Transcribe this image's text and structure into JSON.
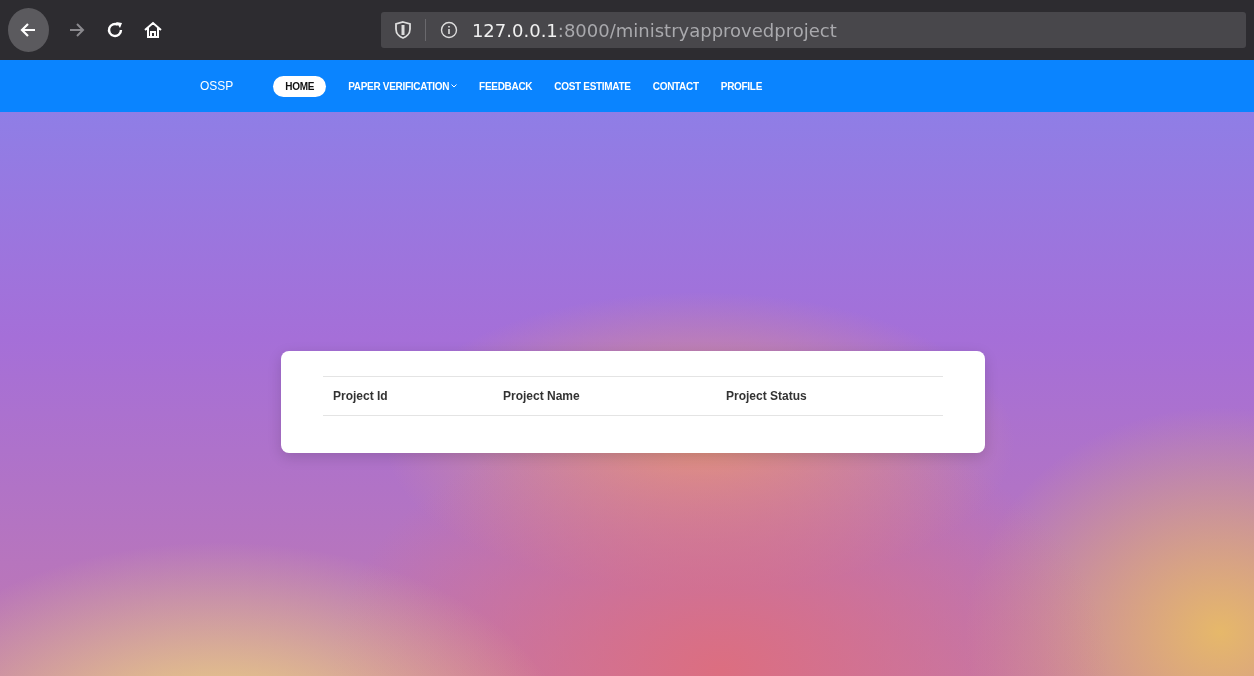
{
  "browser": {
    "url_host": "127.0.0.1",
    "url_path": ":8000/ministryapprovedproject"
  },
  "navbar": {
    "brand": "OSSP",
    "items": [
      {
        "label": "HOME",
        "selected": true,
        "dropdown": false
      },
      {
        "label": "PAPER VERIFICATION",
        "selected": false,
        "dropdown": true
      },
      {
        "label": "FEEDBACK",
        "selected": false,
        "dropdown": false
      },
      {
        "label": "COST ESTIMATE",
        "selected": false,
        "dropdown": false
      },
      {
        "label": "CONTACT",
        "selected": false,
        "dropdown": false
      },
      {
        "label": "PROFILE",
        "selected": false,
        "dropdown": false
      }
    ]
  },
  "table": {
    "columns": [
      "Project Id",
      "Project Name",
      "Project Status"
    ]
  }
}
